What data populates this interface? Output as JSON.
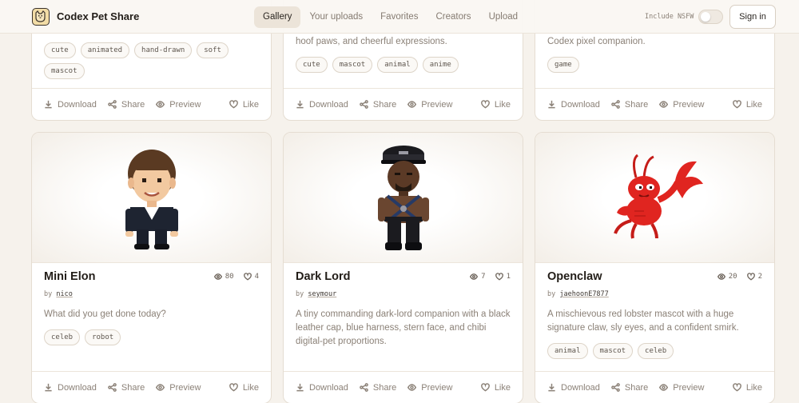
{
  "header": {
    "brand": "Codex Pet Share",
    "nav": [
      "Gallery",
      "Your uploads",
      "Favorites",
      "Creators",
      "Upload"
    ],
    "nsfw_label": "Include NSFW",
    "nsfw_enabled": false,
    "signin_label": "Sign in"
  },
  "actions": {
    "download": "Download",
    "share": "Share",
    "preview": "Preview",
    "like": "Like"
  },
  "top_cards": [
    {
      "desc": "",
      "tags": [
        "cute",
        "animated",
        "hand-drawn",
        "soft",
        "mascot"
      ]
    },
    {
      "desc": "hoof paws, and cheerful expressions.",
      "tags": [
        "cute",
        "mascot",
        "animal",
        "anime"
      ]
    },
    {
      "desc": "Codex pixel companion.",
      "tags": [
        "game"
      ]
    }
  ],
  "cards": [
    {
      "name": "Mini Elon",
      "views": "80",
      "likes": "4",
      "by": "by",
      "author": "nico",
      "desc": "What did you get done today?",
      "tags": [
        "celeb",
        "robot"
      ]
    },
    {
      "name": "Dark Lord",
      "views": "7",
      "likes": "1",
      "by": "by",
      "author": "seymour",
      "desc": "A tiny commanding dark-lord companion with a black leather cap, blue harness, stern face, and chibi digital-pet proportions.",
      "tags": []
    },
    {
      "name": "Openclaw",
      "views": "20",
      "likes": "2",
      "by": "by",
      "author": "jaehoonE7877",
      "desc": "A mischievous red lobster mascot with a huge signature claw, sly eyes, and a confident smirk.",
      "tags": [
        "animal",
        "mascot",
        "celeb"
      ]
    }
  ],
  "colors": {
    "background": "#f6f2ec",
    "card": "#ffffff",
    "accent_active": "#ece4d9",
    "lobster": "#e02520"
  }
}
